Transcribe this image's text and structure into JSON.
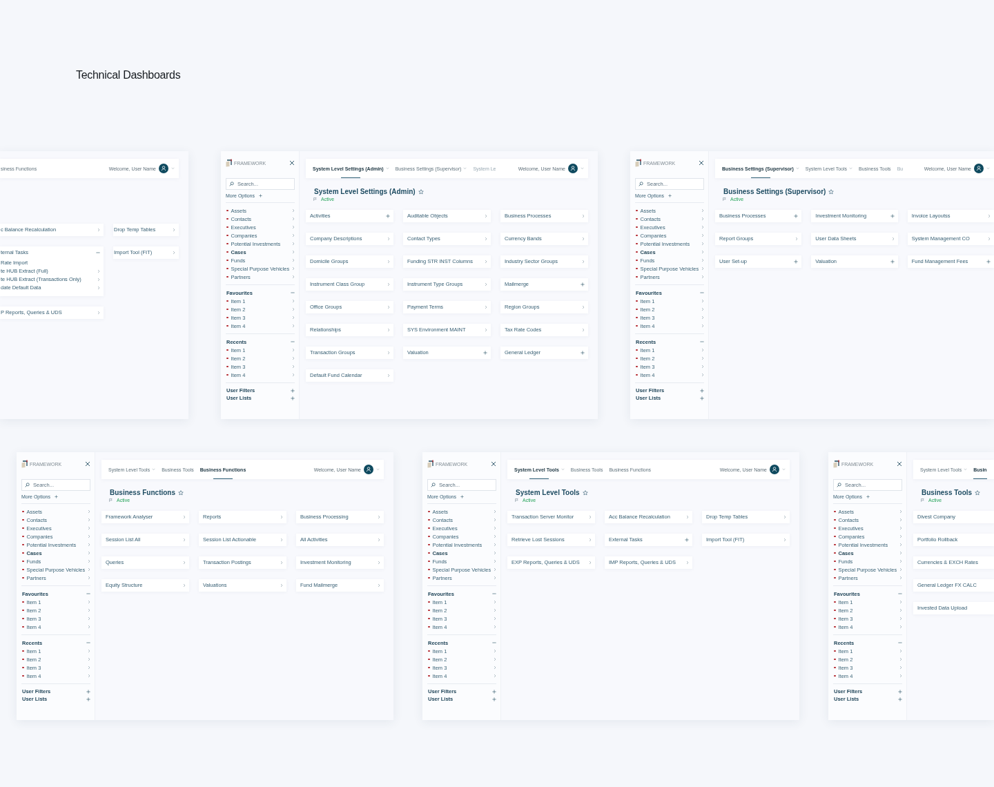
{
  "heading": "Technical Dashboards",
  "rows": [
    [
      {
        "header": {
          "tabs": [
            {
              "label": "siness Functions",
              "selected": false,
              "dropdown": false,
              "faded": false
            }
          ],
          "greeting": "Welcome, User Name"
        },
        "card_columns": [
          [
            {
              "label": "c Balance Recalculation",
              "kind": "link"
            },
            {
              "label": "ternal Tasks",
              "kind": "group",
              "children": [
                {
                  "label": "Rate Import",
                  "kind": "plain"
                },
                {
                  "label": "te HUB Extract (Full)",
                  "kind": "link"
                },
                {
                  "label": "te HUB Extract (Transactions Only)",
                  "kind": "link"
                },
                {
                  "label": "date Default Data",
                  "kind": "link"
                }
              ]
            },
            {
              "label": "P Reports, Queries & UDS",
              "kind": "link"
            }
          ],
          [
            {
              "label": "Drop Temp Tables",
              "kind": "link"
            },
            {
              "label": "Import Tool (FIT)",
              "kind": "link"
            }
          ]
        ]
      },
      {
        "sidebar": {
          "logo": "FRAMEWORK",
          "search": {
            "placeholder": "Search..."
          },
          "more_options": "More Options",
          "nav": [
            {
              "label": "Assets",
              "selected": false
            },
            {
              "label": "Contacts",
              "selected": false
            },
            {
              "label": "Executives",
              "selected": false
            },
            {
              "label": "Companies",
              "selected": false
            },
            {
              "label": "Potential Investments",
              "selected": false
            },
            {
              "label": "Cases",
              "selected": true
            },
            {
              "label": "Funds",
              "selected": false
            },
            {
              "label": "Special Purpose Vehicles",
              "selected": false
            },
            {
              "label": "Partners",
              "selected": false
            }
          ],
          "sections": [
            {
              "title": "Favourites",
              "expanded": true,
              "items": [
                "Item 1",
                "Item 2",
                "Item 3",
                "Item 4"
              ]
            },
            {
              "title": "Recents",
              "expanded": true,
              "items": [
                "Item 1",
                "Item 2",
                "Item 3",
                "Item 4"
              ]
            }
          ],
          "footer": [
            "User Filters",
            "User Lists"
          ]
        },
        "header": {
          "tabs": [
            {
              "label": "System Level Settings (Admin)",
              "selected": true,
              "dropdown": true,
              "faded": false
            },
            {
              "label": "Business Settings (Supervisor)",
              "selected": false,
              "dropdown": true,
              "faded": false
            },
            {
              "label": "System Le",
              "selected": false,
              "dropdown": false,
              "faded": true
            }
          ],
          "greeting": "Welcome, User Name"
        },
        "title": "System Level Settings (Admin)",
        "status": "Active",
        "card_columns": [
          [
            {
              "label": "Activities",
              "kind": "add"
            },
            {
              "label": "Company Descriptions",
              "kind": "link"
            },
            {
              "label": "Domicile Groups",
              "kind": "link"
            },
            {
              "label": "Instrument Class Group",
              "kind": "link"
            },
            {
              "label": "Office Groups",
              "kind": "link"
            },
            {
              "label": "Relationships",
              "kind": "link"
            },
            {
              "label": "Transaction Groups",
              "kind": "link"
            },
            {
              "label": "Default Fund Calendar",
              "kind": "link"
            }
          ],
          [
            {
              "label": "Auditable Objects",
              "kind": "link"
            },
            {
              "label": "Contact Types",
              "kind": "link"
            },
            {
              "label": "Funding STR INST Columns",
              "kind": "link"
            },
            {
              "label": "Instrument Type Groups",
              "kind": "link"
            },
            {
              "label": "Payment Terms",
              "kind": "link"
            },
            {
              "label": "SYS Environment MAINT",
              "kind": "link"
            },
            {
              "label": "Valuation",
              "kind": "add"
            }
          ],
          [
            {
              "label": "Business Processes",
              "kind": "link"
            },
            {
              "label": "Currency Bands",
              "kind": "link"
            },
            {
              "label": "Industry Sector Groups",
              "kind": "link"
            },
            {
              "label": "Mailmerge",
              "kind": "add"
            },
            {
              "label": "Region Groups",
              "kind": "link"
            },
            {
              "label": "Tax Rate Codes",
              "kind": "link"
            },
            {
              "label": "General Ledger",
              "kind": "add"
            }
          ]
        ]
      },
      {
        "sidebar": {
          "logo": "FRAMEWORK",
          "search": {
            "placeholder": "Search..."
          },
          "more_options": "More Options",
          "nav": [
            {
              "label": "Assets",
              "selected": false
            },
            {
              "label": "Contacts",
              "selected": false
            },
            {
              "label": "Executives",
              "selected": false
            },
            {
              "label": "Companies",
              "selected": false
            },
            {
              "label": "Potential Investments",
              "selected": false
            },
            {
              "label": "Cases",
              "selected": true
            },
            {
              "label": "Funds",
              "selected": false
            },
            {
              "label": "Special Purpose Vehicles",
              "selected": false
            },
            {
              "label": "Partners",
              "selected": false
            }
          ],
          "sections": [
            {
              "title": "Favourites",
              "expanded": true,
              "items": [
                "Item 1",
                "Item 2",
                "Item 3",
                "Item 4"
              ]
            },
            {
              "title": "Recents",
              "expanded": true,
              "items": [
                "Item 1",
                "Item 2",
                "Item 3",
                "Item 4"
              ]
            }
          ],
          "footer": [
            "User Filters",
            "User Lists"
          ]
        },
        "header": {
          "tabs": [
            {
              "label": "Business Settings (Supervisor)",
              "selected": true,
              "dropdown": true,
              "faded": false
            },
            {
              "label": "System Level Tools",
              "selected": false,
              "dropdown": true,
              "faded": false
            },
            {
              "label": "Business Tools",
              "selected": false,
              "dropdown": false,
              "faded": false
            },
            {
              "label": "Bu",
              "selected": false,
              "dropdown": false,
              "faded": true
            }
          ],
          "greeting": "Welcome, User Name"
        },
        "title": "Business Settings (Supervisor)",
        "status": "Active",
        "card_columns": [
          [
            {
              "label": "Business Processes",
              "kind": "add"
            },
            {
              "label": "Report Groups",
              "kind": "link"
            },
            {
              "label": "User Set-up",
              "kind": "add"
            }
          ],
          [
            {
              "label": "Investment Monitoring",
              "kind": "add"
            },
            {
              "label": "User Data Sheets",
              "kind": "link"
            },
            {
              "label": "Valuation",
              "kind": "add"
            }
          ],
          [
            {
              "label": "Invoice Layoutss",
              "kind": "link"
            },
            {
              "label": "System Management CO",
              "kind": "link"
            },
            {
              "label": "Fund Management Fees",
              "kind": "add"
            }
          ]
        ]
      }
    ],
    [
      {
        "sidebar": {
          "logo": "FRAMEWORK",
          "search": {
            "placeholder": "Search..."
          },
          "more_options": "More Options",
          "nav": [
            {
              "label": "Assets",
              "selected": false
            },
            {
              "label": "Contacts",
              "selected": false
            },
            {
              "label": "Executives",
              "selected": false
            },
            {
              "label": "Companies",
              "selected": false
            },
            {
              "label": "Potential Investments",
              "selected": false
            },
            {
              "label": "Cases",
              "selected": true
            },
            {
              "label": "Funds",
              "selected": false
            },
            {
              "label": "Special Purpose Vehicles",
              "selected": false
            },
            {
              "label": "Partners",
              "selected": false
            }
          ],
          "sections": [
            {
              "title": "Favourites",
              "expanded": true,
              "items": [
                "Item 1",
                "Item 2",
                "Item 3",
                "Item 4"
              ]
            },
            {
              "title": "Recents",
              "expanded": true,
              "items": [
                "Item 1",
                "Item 2",
                "Item 3",
                "Item 4"
              ]
            }
          ],
          "footer": [
            "User Filters",
            "User Lists"
          ]
        },
        "header": {
          "tabs": [
            {
              "label": "System Level Tools",
              "selected": false,
              "dropdown": true,
              "faded": false
            },
            {
              "label": "Business Tools",
              "selected": false,
              "dropdown": false,
              "faded": false
            },
            {
              "label": "Business Functions",
              "selected": true,
              "dropdown": false,
              "faded": false
            }
          ],
          "greeting": "Welcome, User Name"
        },
        "title": "Business Functions",
        "status": "Active",
        "card_columns": [
          [
            {
              "label": "Framework Analyser",
              "kind": "link"
            },
            {
              "label": "Session List All",
              "kind": "link"
            },
            {
              "label": "Queries",
              "kind": "link"
            },
            {
              "label": "Equity Structure",
              "kind": "link"
            }
          ],
          [
            {
              "label": "Reports",
              "kind": "link"
            },
            {
              "label": "Session List Actionable",
              "kind": "link"
            },
            {
              "label": "Transaction Postings",
              "kind": "link"
            },
            {
              "label": "Valuations",
              "kind": "link"
            }
          ],
          [
            {
              "label": "Business Processing",
              "kind": "link"
            },
            {
              "label": "All Activities",
              "kind": "link"
            },
            {
              "label": "Investment Monitoring",
              "kind": "link"
            },
            {
              "label": "Fund Mailmerge",
              "kind": "link"
            }
          ]
        ]
      },
      {
        "sidebar": {
          "logo": "FRAMEWORK",
          "search": {
            "placeholder": "Search..."
          },
          "more_options": "More Options",
          "nav": [
            {
              "label": "Assets",
              "selected": false
            },
            {
              "label": "Contacts",
              "selected": false
            },
            {
              "label": "Executives",
              "selected": false
            },
            {
              "label": "Companies",
              "selected": false
            },
            {
              "label": "Potential Investments",
              "selected": false
            },
            {
              "label": "Cases",
              "selected": true
            },
            {
              "label": "Funds",
              "selected": false
            },
            {
              "label": "Special Purpose Vehicles",
              "selected": false
            },
            {
              "label": "Partners",
              "selected": false
            }
          ],
          "sections": [
            {
              "title": "Favourites",
              "expanded": true,
              "items": [
                "Item 1",
                "Item 2",
                "Item 3",
                "Item 4"
              ]
            },
            {
              "title": "Recents",
              "expanded": true,
              "items": [
                "Item 1",
                "Item 2",
                "Item 3",
                "Item 4"
              ]
            }
          ],
          "footer": [
            "User Filters",
            "User Lists"
          ]
        },
        "header": {
          "tabs": [
            {
              "label": "System Level Tools",
              "selected": true,
              "dropdown": true,
              "faded": false
            },
            {
              "label": "Business Tools",
              "selected": false,
              "dropdown": false,
              "faded": false
            },
            {
              "label": "Business Functions",
              "selected": false,
              "dropdown": false,
              "faded": false
            }
          ],
          "greeting": "Welcome, User Name"
        },
        "title": "System Level Tools",
        "status": "Active",
        "card_columns": [
          [
            {
              "label": "Transaction Server Monitor",
              "kind": "link"
            },
            {
              "label": "Retrieve Lost Sessions",
              "kind": "link"
            },
            {
              "label": "EXP Reports, Queries & UDS",
              "kind": "link"
            }
          ],
          [
            {
              "label": "Acc Balance Recalculation",
              "kind": "link"
            },
            {
              "label": "External Tasks",
              "kind": "add"
            },
            {
              "label": "IMP Reports, Queries & UDS",
              "kind": "link"
            }
          ],
          [
            {
              "label": "Drop Temp Tables",
              "kind": "link"
            },
            {
              "label": "Import Tool (FIT)",
              "kind": "link"
            }
          ]
        ]
      },
      {
        "sidebar": {
          "logo": "FRAMEWORK",
          "search": {
            "placeholder": "Search..."
          },
          "more_options": "More Options",
          "nav": [
            {
              "label": "Assets",
              "selected": false
            },
            {
              "label": "Contacts",
              "selected": false
            },
            {
              "label": "Executives",
              "selected": false
            },
            {
              "label": "Companies",
              "selected": false
            },
            {
              "label": "Potential Investments",
              "selected": false
            },
            {
              "label": "Cases",
              "selected": true
            },
            {
              "label": "Funds",
              "selected": false
            },
            {
              "label": "Special Purpose Vehicles",
              "selected": false
            },
            {
              "label": "Partners",
              "selected": false
            }
          ],
          "sections": [
            {
              "title": "Favourites",
              "expanded": true,
              "items": [
                "Item 1",
                "Item 2",
                "Item 3",
                "Item 4"
              ]
            },
            {
              "title": "Recents",
              "expanded": true,
              "items": [
                "Item 1",
                "Item 2",
                "Item 3",
                "Item 4"
              ]
            }
          ],
          "footer": [
            "User Filters",
            "User Lists"
          ]
        },
        "header": {
          "tabs": [
            {
              "label": "System Level Tools",
              "selected": false,
              "dropdown": true,
              "faded": false
            },
            {
              "label": "Busin",
              "selected": true,
              "dropdown": false,
              "faded": false
            }
          ]
        },
        "title": "Business Tools",
        "status": "Active",
        "card_columns": [
          [
            {
              "label": "Divest Company",
              "kind": "plain"
            },
            {
              "label": "Portfolio Rollback",
              "kind": "plain"
            },
            {
              "label": "Currencies & EXCH Rates",
              "kind": "plain"
            },
            {
              "label": "General Ledger FX CALC",
              "kind": "plain"
            },
            {
              "label": "Invested Data Upload",
              "kind": "plain"
            }
          ]
        ]
      }
    ]
  ]
}
